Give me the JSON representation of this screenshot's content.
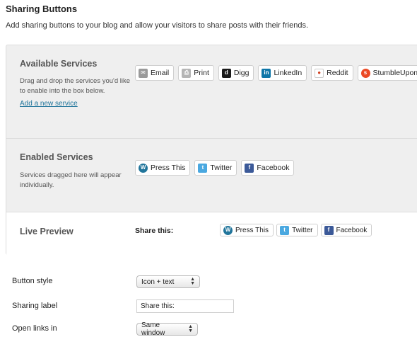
{
  "page": {
    "title": "Sharing Buttons",
    "description": "Add sharing buttons to your blog and allow your visitors to share posts with their friends."
  },
  "available": {
    "heading": "Available Services",
    "note": "Drag and drop the services you'd like to enable into the box below.",
    "add_link": "Add a new service",
    "services": [
      "Email",
      "Print",
      "Digg",
      "LinkedIn",
      "Reddit",
      "StumbleUpon"
    ]
  },
  "enabled": {
    "heading": "Enabled Services",
    "note": "Services dragged here will appear individually.",
    "services": [
      "Press This",
      "Twitter",
      "Facebook"
    ]
  },
  "preview": {
    "heading": "Live Preview",
    "share_label": "Share this:",
    "services": [
      "Press This",
      "Twitter",
      "Facebook"
    ]
  },
  "settings": {
    "button_style_label": "Button style",
    "button_style_value": "Icon + text",
    "sharing_label_label": "Sharing label",
    "sharing_label_value": "Share this:",
    "open_links_label": "Open links in",
    "open_links_value": "Same window"
  },
  "icons": {
    "email": "email-icon",
    "print": "print-icon",
    "digg": "digg-icon",
    "linkedin": "linkedin-icon",
    "reddit": "reddit-icon",
    "stumbleupon": "stumbleupon-icon",
    "press_this": "wordpress-icon",
    "twitter": "twitter-icon",
    "facebook": "facebook-icon"
  },
  "colors": {
    "link": "#21759b",
    "panel_bg": "#efefef",
    "linkedin": "#0e76a8",
    "stumbleupon": "#eb4924",
    "twitter": "#4aa8e0",
    "facebook": "#3b5998"
  }
}
